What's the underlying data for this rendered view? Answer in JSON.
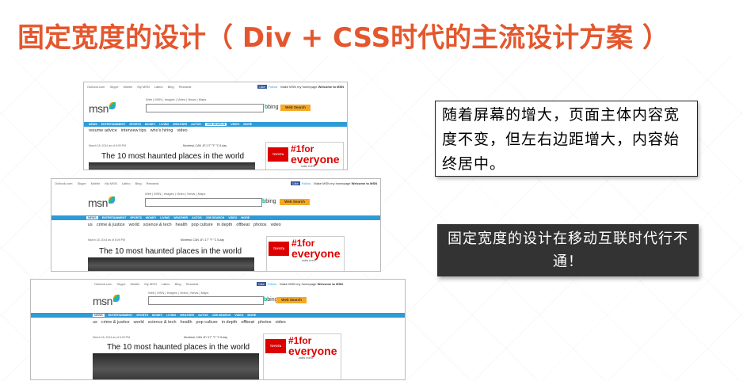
{
  "slide": {
    "title": "固定宽度的设计（ Div + CSS时代的主流设计方案 ）",
    "note1": "随着屏幕的增大，页面主体内容宽度不变，但左右边距增大，内容始终居中。",
    "note2": "固定宽度的设计在移动互联时代行不通！"
  },
  "msn": {
    "top_links": [
      "Outlook.com",
      "Skype",
      "Mobile",
      "My MSN",
      "Latino",
      "Bing",
      "Rewards"
    ],
    "fb_label": "Like",
    "follow_label": "Follow",
    "make_homepage": "Make MSN my homepage",
    "welcome": "Welcome to MSN",
    "page_options": "Page options | Sign in",
    "sub_links": "Web | MSN | Images | Video | News | Maps",
    "logo_text": "msn",
    "bing_label": "bing",
    "web_search_label": "Web Search",
    "nav": [
      "NEWS",
      "ENTERTAINMENT",
      "SPORTS",
      "MONEY",
      "LIVING",
      "WEATHER",
      "AUTOS",
      "JOB SEARCH",
      "VIDEO",
      "MORE"
    ],
    "subnav_jobs": [
      "resume advice",
      "interview tips",
      "who's hiring",
      "video"
    ],
    "subnav_news": [
      "us",
      "crime & justice",
      "world",
      "science & tech",
      "health",
      "pop culture",
      "in depth",
      "offbeat",
      "photos",
      "video"
    ],
    "date": "March 18, 2014 as of 6:09 PM",
    "weather": "Montreal, CAN",
    "weather_temp": "-8°/-17° °F °C 5-day",
    "headline": "The 10 most haunted places in the world",
    "ad_brand": "TOYOTA",
    "ad_line1": "#1for",
    "ad_line2": "everyone",
    "ad_line3": "sales event"
  }
}
